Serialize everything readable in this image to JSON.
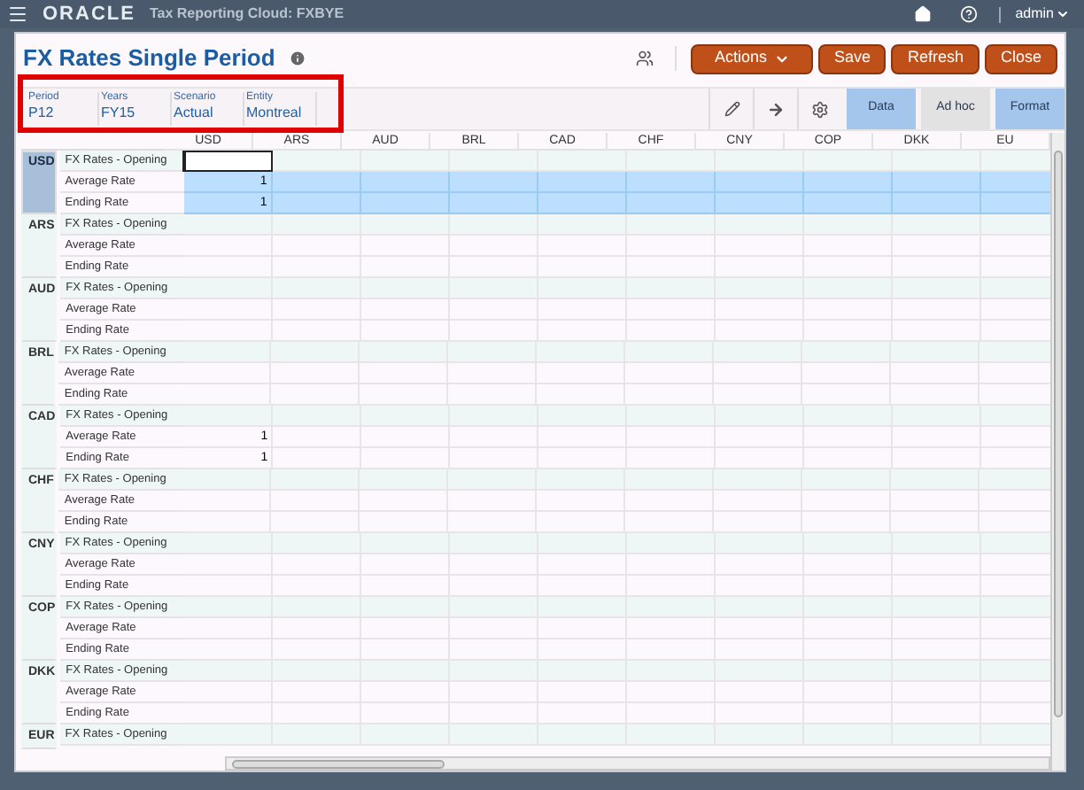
{
  "top_bar": {
    "logo": "ORACLE",
    "app_title": "Tax Reporting Cloud: FXBYE",
    "user": "admin"
  },
  "form": {
    "title": "FX Rates Single Period"
  },
  "actions": [
    {
      "label": "Actions",
      "kind": "menu"
    },
    {
      "label": "Save",
      "kind": "button"
    },
    {
      "label": "Refresh",
      "kind": "button"
    },
    {
      "label": "Close",
      "kind": "button"
    }
  ],
  "pov": [
    {
      "label": "Period",
      "value": "P12"
    },
    {
      "label": "Years",
      "value": "FY15"
    },
    {
      "label": "Scenario",
      "value": "Actual"
    },
    {
      "label": "Entity",
      "value": "Montreal"
    }
  ],
  "pov_highlighted": true,
  "tabs": [
    {
      "label": "Data",
      "selected": true
    },
    {
      "label": "Ad hoc",
      "selected": false
    },
    {
      "label": "Format",
      "selected": true
    }
  ],
  "columns": [
    "USD",
    "ARS",
    "AUD",
    "BRL",
    "CAD",
    "CHF",
    "CNY",
    "COP",
    "DKK",
    "EU"
  ],
  "currencies": [
    {
      "code": "USD",
      "selected": true,
      "rows": [
        {
          "label": "FX Rates - Opening",
          "values": []
        },
        {
          "label": "Average Rate",
          "values": [
            "1"
          ]
        },
        {
          "label": "Ending Rate",
          "values": [
            "1"
          ]
        }
      ]
    },
    {
      "code": "ARS",
      "selected": false,
      "rows": [
        {
          "label": "FX Rates - Opening",
          "values": []
        },
        {
          "label": "Average Rate",
          "values": []
        },
        {
          "label": "Ending Rate",
          "values": []
        }
      ]
    },
    {
      "code": "AUD",
      "selected": false,
      "rows": [
        {
          "label": "FX Rates - Opening",
          "values": []
        },
        {
          "label": "Average Rate",
          "values": []
        },
        {
          "label": "Ending Rate",
          "values": []
        }
      ]
    },
    {
      "code": "BRL",
      "selected": false,
      "rows": [
        {
          "label": "FX Rates - Opening",
          "values": []
        },
        {
          "label": "Average Rate",
          "values": []
        },
        {
          "label": "Ending Rate",
          "values": []
        }
      ]
    },
    {
      "code": "CAD",
      "selected": false,
      "rows": [
        {
          "label": "FX Rates - Opening",
          "values": []
        },
        {
          "label": "Average Rate",
          "values": [
            "1"
          ]
        },
        {
          "label": "Ending Rate",
          "values": [
            "1"
          ]
        }
      ]
    },
    {
      "code": "CHF",
      "selected": false,
      "rows": [
        {
          "label": "FX Rates - Opening",
          "values": []
        },
        {
          "label": "Average Rate",
          "values": []
        },
        {
          "label": "Ending Rate",
          "values": []
        }
      ]
    },
    {
      "code": "CNY",
      "selected": false,
      "rows": [
        {
          "label": "FX Rates - Opening",
          "values": []
        },
        {
          "label": "Average Rate",
          "values": []
        },
        {
          "label": "Ending Rate",
          "values": []
        }
      ]
    },
    {
      "code": "COP",
      "selected": false,
      "rows": [
        {
          "label": "FX Rates - Opening",
          "values": []
        },
        {
          "label": "Average Rate",
          "values": []
        },
        {
          "label": "Ending Rate",
          "values": []
        }
      ]
    },
    {
      "code": "DKK",
      "selected": false,
      "rows": [
        {
          "label": "FX Rates - Opening",
          "values": []
        },
        {
          "label": "Average Rate",
          "values": []
        },
        {
          "label": "Ending Rate",
          "values": []
        }
      ]
    },
    {
      "code": "EUR",
      "selected": false,
      "rows": [
        {
          "label": "FX Rates - Opening",
          "values": []
        }
      ]
    }
  ]
}
